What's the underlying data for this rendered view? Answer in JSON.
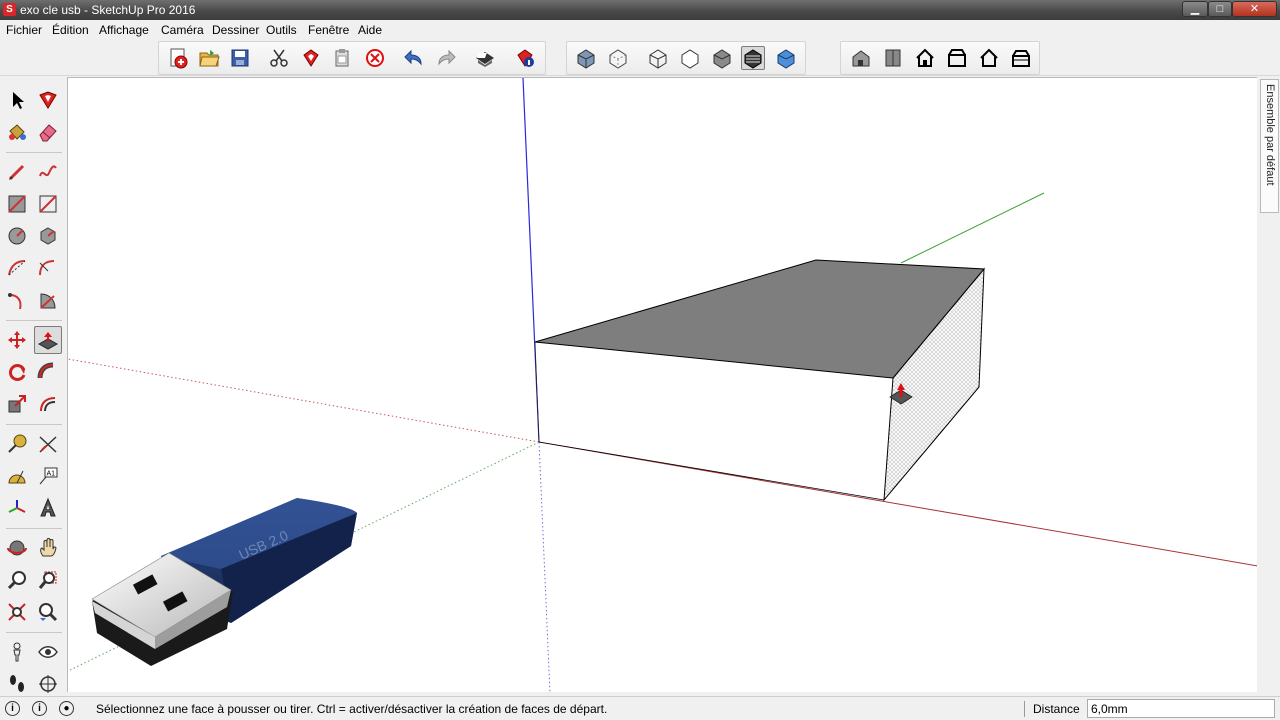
{
  "window": {
    "title": "exo cle usb - SketchUp Pro 2016",
    "app_icon_letter": "S"
  },
  "menu": [
    "Fichier",
    "Édition",
    "Affichage",
    "Caméra",
    "Dessiner",
    "Outils",
    "Fenêtre",
    "Aide"
  ],
  "window_buttons": {
    "minimize": "▁",
    "maximize": "□",
    "close": "✕"
  },
  "tray": {
    "tab_label": "Ensemble par défaut"
  },
  "usb_label": "USB 2.0",
  "status": {
    "message": "Sélectionnez une face à pousser ou tirer.  Ctrl = activer/désactiver la création de faces de départ.",
    "icon1": "i",
    "icon2": "i",
    "icon3": "●"
  },
  "measurement": {
    "label": "Distance",
    "value": "6,0mm"
  },
  "colors": {
    "red_axis": "#a83232",
    "green_axis": "#3aa336",
    "blue_axis": "#2a2ad8",
    "face_top": "#7e7e7e",
    "usb_body": "#1e3263"
  }
}
